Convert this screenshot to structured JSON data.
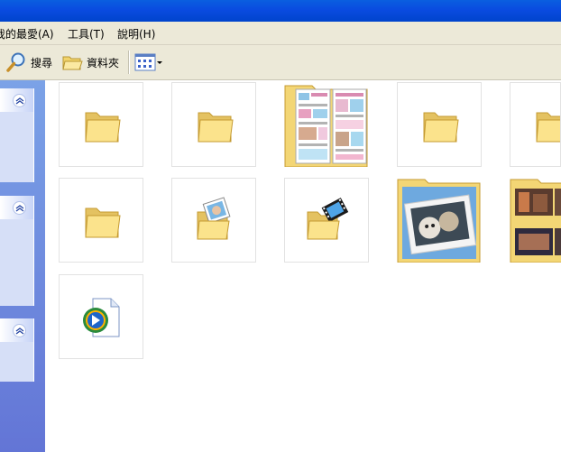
{
  "menu": {
    "favorites": "我的最愛(A)",
    "tools": "工具(T)",
    "help": "說明(H)"
  },
  "toolbar": {
    "search_label": "搜尋",
    "folders_label": "資料夾"
  },
  "colors": {
    "titlebar": "#0a50e0",
    "sidebar": "#6f8ee0",
    "folder": "#f7de7f"
  },
  "icons": [
    "search-icon",
    "folders-icon",
    "view-menu-icon",
    "collapse-chevron-icon",
    "folder-icon",
    "picture-folder-icon",
    "video-folder-icon",
    "media-file-icon"
  ],
  "tiles": [
    {
      "kind": "folder"
    },
    {
      "kind": "folder"
    },
    {
      "kind": "folder-with-thumbnails"
    },
    {
      "kind": "folder"
    },
    {
      "kind": "folder"
    },
    {
      "kind": "folder"
    },
    {
      "kind": "pictures-folder"
    },
    {
      "kind": "videos-folder"
    },
    {
      "kind": "folder-with-photo"
    },
    {
      "kind": "folder-with-photos"
    },
    {
      "kind": "media-file"
    }
  ]
}
